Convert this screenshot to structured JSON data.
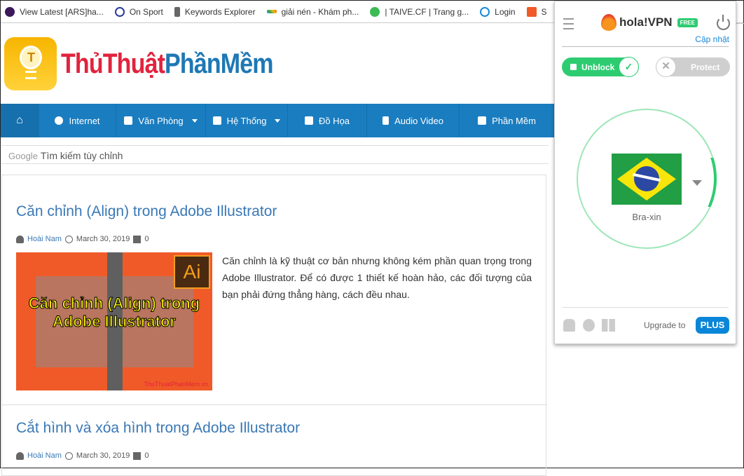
{
  "bookmarks": [
    {
      "label": "View Latest [ARS]ha...",
      "icon": "premier-league-icon",
      "color": "#3d195b"
    },
    {
      "label": "On Sport",
      "icon": "power-logo-icon",
      "color": "#2b3a9a"
    },
    {
      "label": "Keywords Explorer",
      "icon": "ahrefs-b-icon",
      "color": "#555"
    },
    {
      "label": "giải nén - Khám ph...",
      "icon": "google-trends-icon",
      "color": "#e94235"
    },
    {
      "label": "| TAIVE.CF | Trang g...",
      "icon": "download-icon",
      "color": "#3cba54"
    },
    {
      "label": "Login",
      "icon": "windows-logo-icon",
      "color": "#1c8ad8"
    },
    {
      "label": "S",
      "icon": "shopee-icon",
      "color": "#f05a28"
    }
  ],
  "site": {
    "logo_part1": "ThủThuật",
    "logo_part2": "PhầnMềm"
  },
  "nav": [
    {
      "label": "",
      "icon": "home-icon"
    },
    {
      "label": "Internet",
      "icon": "globe-icon"
    },
    {
      "label": "Văn Phòng",
      "icon": "word-doc-icon",
      "dropdown": true
    },
    {
      "label": "Hệ Thống",
      "icon": "windows-icon",
      "dropdown": true
    },
    {
      "label": "Đồ Họa",
      "icon": "image-icon"
    },
    {
      "label": "Audio Video",
      "icon": "video-file-icon"
    },
    {
      "label": "Phần Mềm",
      "icon": "grid-icon"
    }
  ],
  "search": {
    "brand": "Google",
    "placeholder": "Tìm kiếm tùy chỉnh"
  },
  "posts": [
    {
      "title": "Căn chỉnh (Align) trong Adobe Illustrator",
      "author": "Hoài Nam",
      "date": "March 30, 2019",
      "comments": "0",
      "thumb_caption": "Căn chỉnh (Align) trong Adobe Illustrator",
      "thumb_badge": "Ai",
      "thumb_watermark": "ThuThuatPhanMem.vn",
      "excerpt": "Căn chỉnh là kỹ thuật cơ bản nhưng không kém phần quan trọng trong Adobe Illustrator. Để có được 1 thiết kế hoàn hảo, các đối tượng của bạn phải đứng thẳng hàng, cách đều nhau."
    },
    {
      "title": "Cắt hình và xóa hình trong Adobe Illustrator",
      "author": "Hoài Nam",
      "date": "March 30, 2019",
      "comments": "0"
    }
  ],
  "vpn": {
    "brand": "hola!VPN",
    "badge": "FREE",
    "update": "Cập nhật",
    "unblock": "Unblock",
    "protect": "Protect",
    "country": "Bra-xin",
    "upgrade": "Upgrade to",
    "plus": "PLUS",
    "accent": "#2ecc71",
    "connected": true
  }
}
